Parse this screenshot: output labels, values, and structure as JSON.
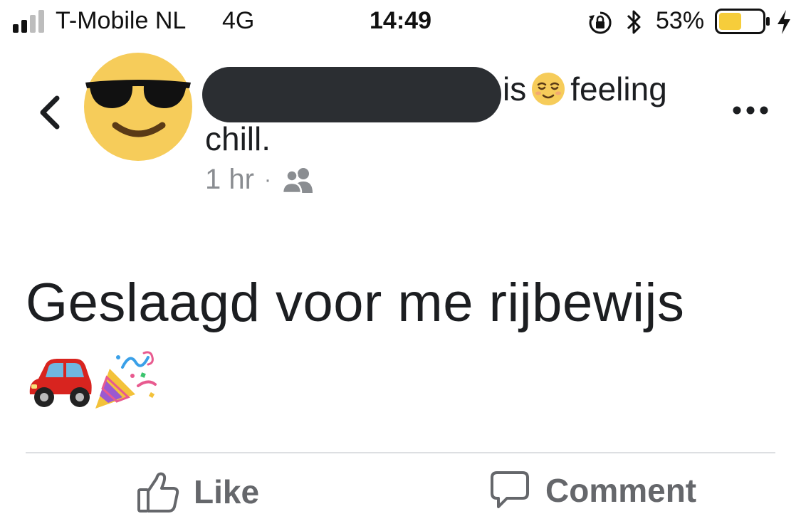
{
  "status_bar": {
    "carrier": "T-Mobile NL",
    "network": "4G",
    "time": "14:49",
    "battery_percent": "53%",
    "battery_level": 0.53,
    "icons": [
      "signal-icon",
      "rotation-lock-icon",
      "bluetooth-icon",
      "battery-icon",
      "charging-icon"
    ]
  },
  "post": {
    "author_redacted": true,
    "header_verb": "is",
    "feeling_emoji": "relieved-face-emoji",
    "feeling_word": "feeling",
    "feeling_value": "chill.",
    "timestamp": "1 hr",
    "separator": "·",
    "audience_icon": "friends-icon",
    "text": "Geslaagd voor me rijbewijs",
    "emojis": [
      "car-emoji",
      "party-popper-emoji"
    ]
  },
  "actions": {
    "like_label": "Like",
    "comment_label": "Comment"
  },
  "colors": {
    "text": "#1c1e21",
    "meta": "#8a8d91",
    "action": "#65676b",
    "redaction": "#2b2e32",
    "battery_fill": "#f6cd3b"
  }
}
